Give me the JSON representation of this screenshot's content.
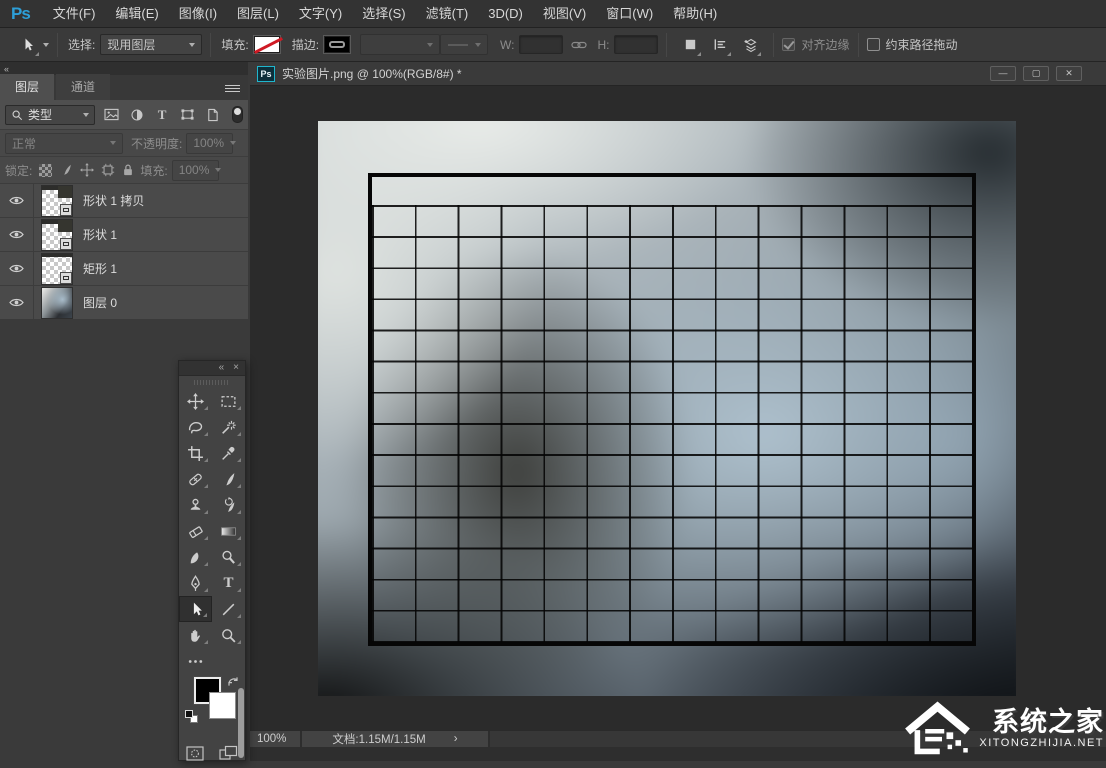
{
  "app": {
    "logo": "Ps"
  },
  "menu": {
    "items": [
      {
        "label": "文件(F)"
      },
      {
        "label": "编辑(E)"
      },
      {
        "label": "图像(I)"
      },
      {
        "label": "图层(L)"
      },
      {
        "label": "文字(Y)"
      },
      {
        "label": "选择(S)"
      },
      {
        "label": "滤镜(T)"
      },
      {
        "label": "3D(D)"
      },
      {
        "label": "视图(V)"
      },
      {
        "label": "窗口(W)"
      },
      {
        "label": "帮助(H)"
      }
    ]
  },
  "options": {
    "select_label": "选择:",
    "select_value": "现用图层",
    "fill_label": "填充:",
    "stroke_label": "描边:",
    "w_label": "W:",
    "h_label": "H:",
    "w_value": "",
    "h_value": "",
    "align_edges_label": "对齐边缘",
    "constrain_label": "约束路径拖动"
  },
  "layers_panel": {
    "tabs": [
      {
        "label": "图层"
      },
      {
        "label": "通道"
      }
    ],
    "filter_label": "类型",
    "blend_mode": "正常",
    "opacity_label": "不透明度:",
    "opacity_value": "100%",
    "lock_label": "锁定:",
    "fill_label": "填充:",
    "fill_value": "100%",
    "items": [
      {
        "name": "形状 1 拷贝"
      },
      {
        "name": "形状 1"
      },
      {
        "name": "矩形 1"
      },
      {
        "name": "图层 0"
      }
    ]
  },
  "toolbar": {
    "tools": [
      "move",
      "marquee",
      "lasso",
      "quick-selection",
      "crop",
      "eyedropper",
      "spot-healing",
      "brush",
      "clone-stamp",
      "history-brush",
      "eraser",
      "gradient",
      "smudge",
      "dodge",
      "pen",
      "type",
      "path-selection",
      "line",
      "hand",
      "zoom",
      "edit-toolbar"
    ],
    "selected_tool": "path-selection",
    "foreground_color": "#000000",
    "background_color": "#ffffff"
  },
  "document": {
    "icon": "Ps",
    "title": "实验图片.png @ 100%(RGB/8#) *",
    "zoom": "100%",
    "info": "文档:1.15M/1.15M",
    "chevron": "›",
    "minimize": "—",
    "maximize": "▢",
    "close": "✕"
  },
  "colors": {
    "ps_blue": "#2d9fd8",
    "doc_icon_teal": "#1fb6cd",
    "fill_none_red": "#cf1a24"
  },
  "watermark": {
    "title": "系统之家",
    "subtitle": "XITONGZHIJIA.NET"
  }
}
